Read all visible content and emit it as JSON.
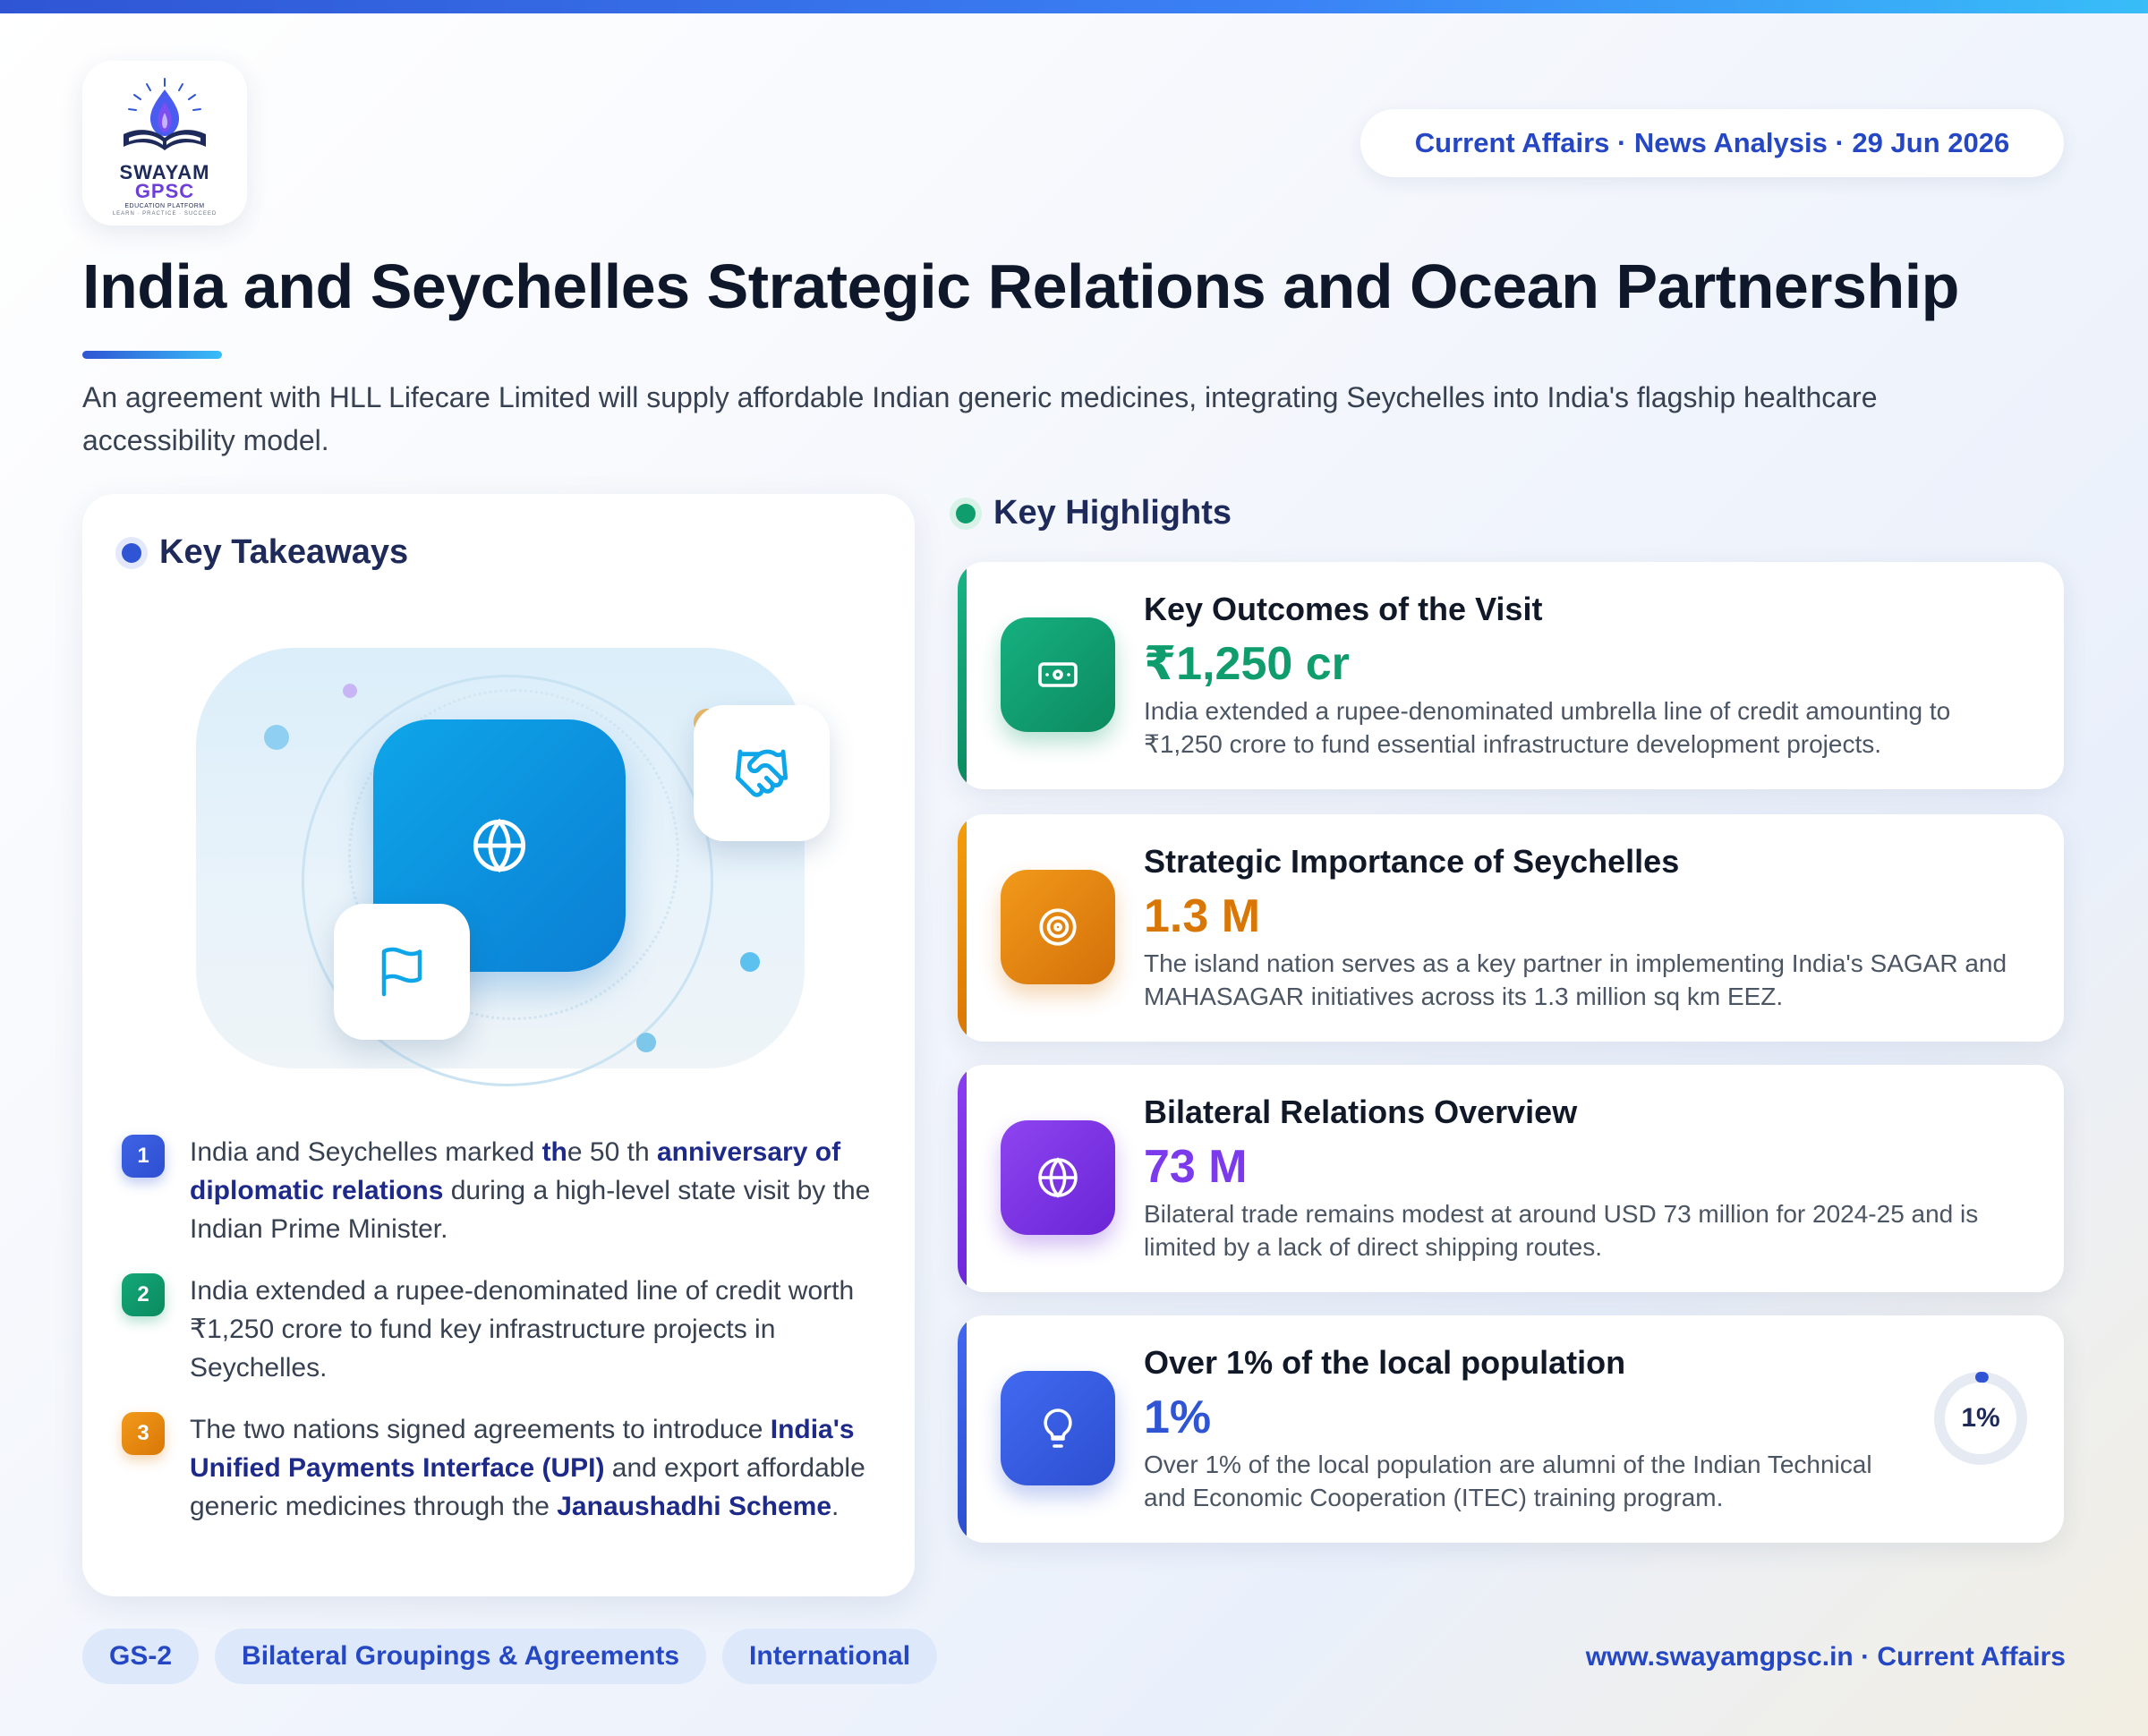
{
  "brand": {
    "logo_line1": "SWAYAM",
    "logo_line2": "GPSC",
    "logo_line3": "EDUCATION PLATFORM",
    "logo_line4": "LEARN · PRACTICE · SUCCEED"
  },
  "header": {
    "date_pill": "Current Affairs · News Analysis · 29 Jun 2026",
    "title": "India and Seychelles Strategic Relations and Ocean Partnership",
    "subtitle": "An agreement with HLL Lifecare Limited will supply affordable Indian generic medicines, integrating Seychelles into India's flagship healthcare accessibility model."
  },
  "takeaways": {
    "heading": "Key Takeaways",
    "items": [
      {
        "num": "1",
        "parts": [
          "India and Seychelles marked ",
          "th",
          "e 50 th ",
          "anniversary of diplomatic relations",
          " during a high-level state visit by the Indian Prime Minister."
        ]
      },
      {
        "num": "2",
        "text": "India extended a rupee-denominated line of credit worth ₹1,250 crore to fund key infrastructure projects in Seychelles."
      },
      {
        "num": "3",
        "parts": [
          "The two nations signed agreements to introduce ",
          "India's Unified Payments Interface (UPI)",
          " and export affordable generic medicines through the ",
          "Janaushadhi Scheme",
          "."
        ]
      }
    ]
  },
  "highlights": {
    "heading": "Key Highlights",
    "cards": [
      {
        "title": "Key Outcomes of the Visit",
        "value": "₹1,250 cr",
        "desc": "India extended a rupee-denominated umbrella line of credit amounting to ₹1,250 crore to fund essential infrastructure development projects.",
        "icon": "money-icon",
        "color": "#0f9d6e"
      },
      {
        "title": "Strategic Importance of Seychelles",
        "value": "1.3 M",
        "desc": "The island nation serves as a key partner in implementing India's SAGAR and MAHASAGAR initiatives across its 1.3 million sq km EEZ.",
        "icon": "target-icon",
        "color": "#d97706"
      },
      {
        "title": "Bilateral Relations Overview",
        "value": "73 M",
        "desc": "Bilateral trade remains modest at around USD 73 million for 2024-25 and is limited by a lack of direct shipping routes.",
        "icon": "globe-icon",
        "color": "#7c3aed"
      },
      {
        "title": "Over 1% of the local population",
        "value": "1%",
        "desc": "Over 1% of the local population are alumni of the Indian Technical and Economic Cooperation (ITEC) training program.",
        "icon": "lightbulb-icon",
        "color": "#2f55d4",
        "gauge_label": "1%",
        "gauge_fraction": 0.01
      }
    ]
  },
  "footer": {
    "tags": [
      "GS-2",
      "Bilateral Groupings & Agreements",
      "International"
    ],
    "site": "www.swayamgpsc.in · Current Affairs"
  }
}
